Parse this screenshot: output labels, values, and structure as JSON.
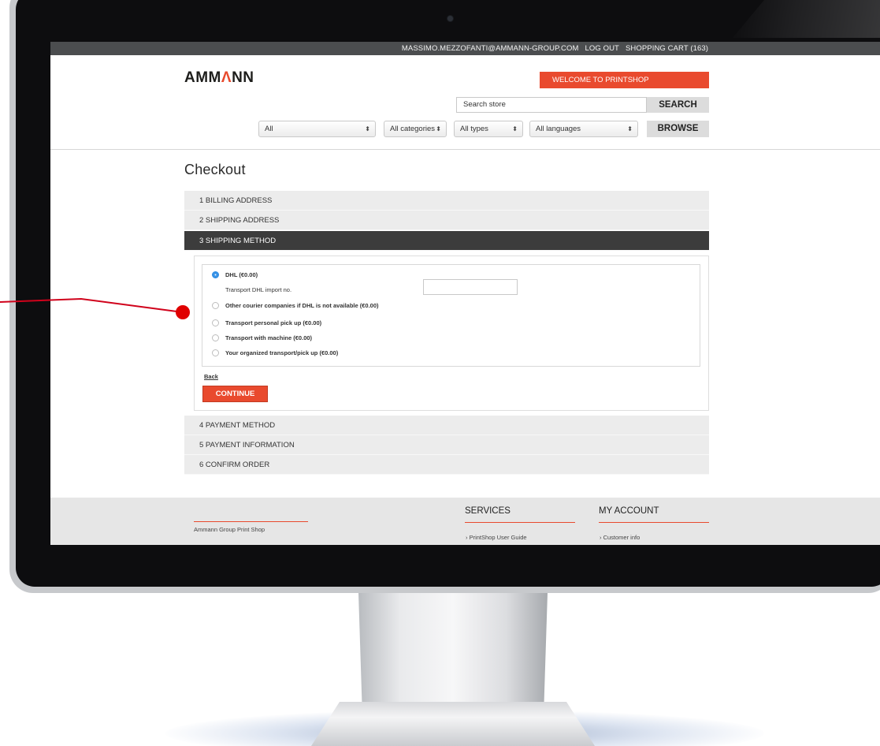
{
  "topbar": {
    "email": "MASSIMO.MEZZOFANTI@AMMANN-GROUP.COM",
    "logout": "LOG OUT",
    "cart": "SHOPPING CART (163)"
  },
  "header": {
    "logo_part1": "AMM",
    "logo_accent": "Λ",
    "logo_part2": "NN",
    "welcome": "WELCOME TO PRINTSHOP",
    "search_placeholder": "Search store",
    "search_button": "SEARCH",
    "filters": [
      "All",
      "All categories",
      "All types",
      "All languages"
    ],
    "browse_button": "BROWSE"
  },
  "checkout": {
    "title": "Checkout",
    "steps": [
      "1  BILLING ADDRESS",
      "2  SHIPPING ADDRESS",
      "3  SHIPPING METHOD",
      "4  PAYMENT METHOD",
      "5  PAYMENT INFORMATION",
      "6  CONFIRM ORDER"
    ],
    "options": [
      "DHL (€0.00)",
      "Other courier companies if DHL is not available (€0.00)",
      "Transport personal pick up (€0.00)",
      "Transport with machine (€0.00)",
      "Your organized transport/pick up (€0.00)"
    ],
    "dhl_field_label": "Transport DHL import no.",
    "back": "Back",
    "continue": "CONTINUE"
  },
  "footer": {
    "brand": "Ammann Group Print Shop",
    "services_title": "SERVICES",
    "services_link": "› PrintShop User Guide",
    "account_title": "MY ACCOUNT",
    "account_link": "› Customer info"
  },
  "colors": {
    "accent": "#e94a2e",
    "topbar": "#4b4d4f",
    "active_step": "#3c3c3c",
    "radio_checked": "#2f8de4",
    "annotation": "#d0021b"
  }
}
